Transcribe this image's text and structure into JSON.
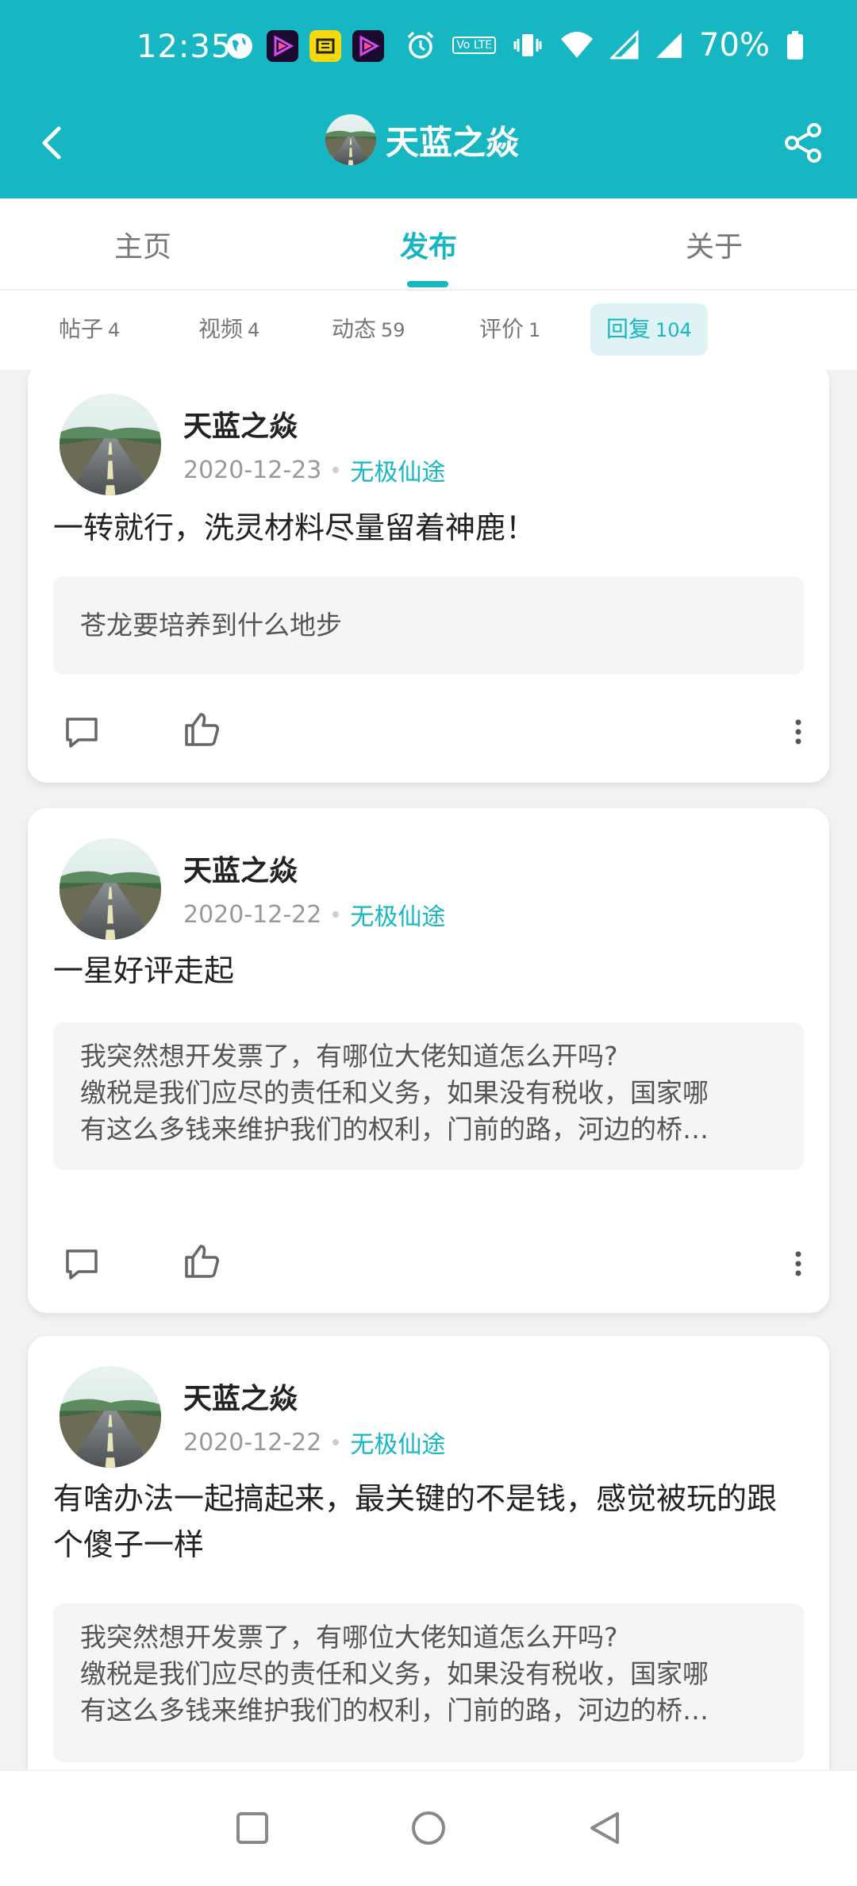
{
  "status_bar": {
    "time": "12:35",
    "battery_text": "70%",
    "left_icons": [
      "globe-icon",
      "app-play-icon",
      "app-yellow-icon",
      "app-play-icon"
    ],
    "right_icons": [
      "alarm-icon",
      "volte-icon",
      "vibrate-icon",
      "wifi-icon",
      "signal-icon",
      "signal-icon",
      "battery-icon"
    ],
    "lte_badge": "Vo LTE"
  },
  "header": {
    "title": "天蓝之焱",
    "back_icon": "chevron-left-icon",
    "share_icon": "share-icon"
  },
  "tabs": [
    {
      "label": "主页",
      "active": false
    },
    {
      "label": "发布",
      "active": true
    },
    {
      "label": "关于",
      "active": false
    }
  ],
  "subtabs": [
    {
      "label": "帖子",
      "count": "4",
      "active": false
    },
    {
      "label": "视频",
      "count": "4",
      "active": false
    },
    {
      "label": "动态",
      "count": "59",
      "active": false
    },
    {
      "label": "评价",
      "count": "1",
      "active": false
    },
    {
      "label": "回复",
      "count": "104",
      "active": true
    }
  ],
  "posts": [
    {
      "author": "天蓝之焱",
      "date": "2020-12-23",
      "game": "无极仙途",
      "text": "一转就行，洗灵材料尽量留着神鹿！",
      "quote": [
        "苍龙要培养到什么地步"
      ]
    },
    {
      "author": "天蓝之焱",
      "date": "2020-12-22",
      "game": "无极仙途",
      "text": "一星好评走起",
      "quote": [
        "我突然想开发票了，有哪位大佬知道怎么开吗?",
        "缴税是我们应尽的责任和义务，如果没有税收，国家哪",
        "有这么多钱来维护我们的权利，门前的路，河边的桥…"
      ]
    },
    {
      "author": "天蓝之焱",
      "date": "2020-12-22",
      "game": "无极仙途",
      "text": "有啥办法一起搞起来，最关键的不是钱，感觉被玩的跟个傻子一样",
      "quote": [
        "我突然想开发票了，有哪位大佬知道怎么开吗?",
        "缴税是我们应尽的责任和义务，如果没有税收，国家哪",
        "有这么多钱来维护我们的权利，门前的路，河边的桥…"
      ]
    }
  ],
  "nav_bar": [
    "recents-square-icon",
    "home-circle-icon",
    "back-triangle-icon"
  ],
  "colors": {
    "accent": "#17b6c3",
    "background": "#f2f2f2"
  }
}
